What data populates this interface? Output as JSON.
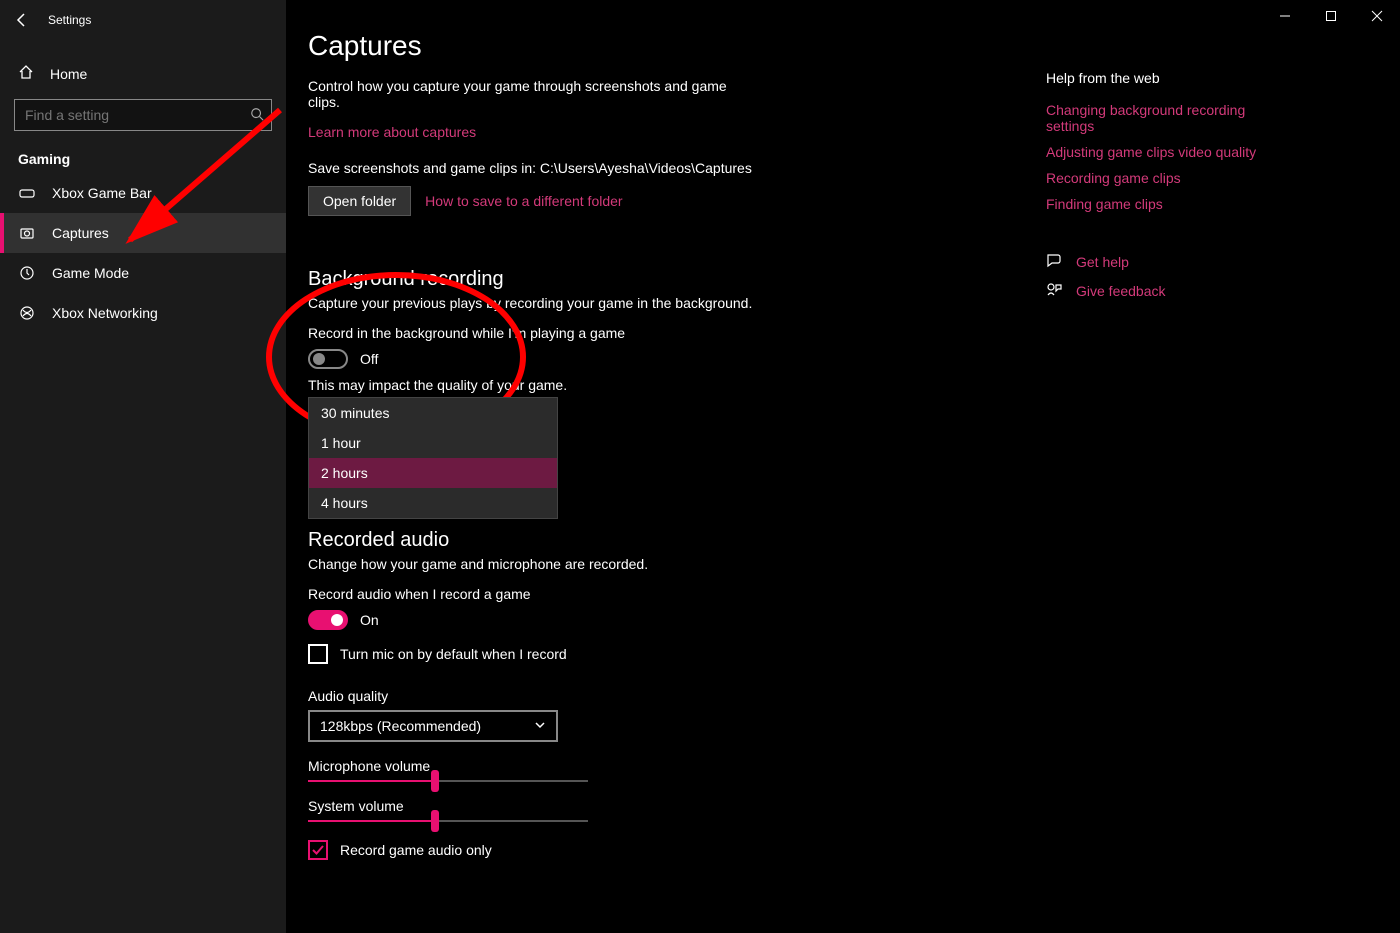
{
  "window": {
    "title": "Settings"
  },
  "sidebar": {
    "home": "Home",
    "search_placeholder": "Find a setting",
    "section": "Gaming",
    "items": [
      {
        "label": "Xbox Game Bar"
      },
      {
        "label": "Captures"
      },
      {
        "label": "Game Mode"
      },
      {
        "label": "Xbox Networking"
      }
    ]
  },
  "page": {
    "title": "Captures",
    "intro": "Control how you capture your game through screenshots and game clips.",
    "learn_link": "Learn more about captures",
    "save_path_label": "Save screenshots and game clips in: C:\\Users\\Ayesha\\Videos\\Captures",
    "open_folder_btn": "Open folder",
    "diff_folder_link": "How to save to a different folder"
  },
  "bg": {
    "heading": "Background recording",
    "desc": "Capture your previous plays by recording your game in the background.",
    "toggle_label": "Record in the background while I'm playing a game",
    "toggle_state": "Off",
    "impact_note": "This may impact the quality of your game.",
    "options": [
      "30 minutes",
      "1 hour",
      "2 hours",
      "4 hours"
    ],
    "selected_option": "2 hours"
  },
  "audio": {
    "heading": "Recorded audio",
    "desc": "Change how your game and microphone are recorded.",
    "toggle_label": "Record audio when I record a game",
    "toggle_state": "On",
    "mic_default_label": "Turn mic on by default when I record",
    "quality_label": "Audio quality",
    "quality_value": "128kbps (Recommended)",
    "mic_vol_label": "Microphone volume",
    "mic_vol": 44,
    "sys_vol_label": "System volume",
    "sys_vol": 44,
    "game_only_label": "Record game audio only"
  },
  "help": {
    "heading": "Help from the web",
    "links": [
      "Changing background recording settings",
      "Adjusting game clips video quality",
      "Recording game clips",
      "Finding game clips"
    ],
    "get_help": "Get help",
    "feedback": "Give feedback"
  }
}
